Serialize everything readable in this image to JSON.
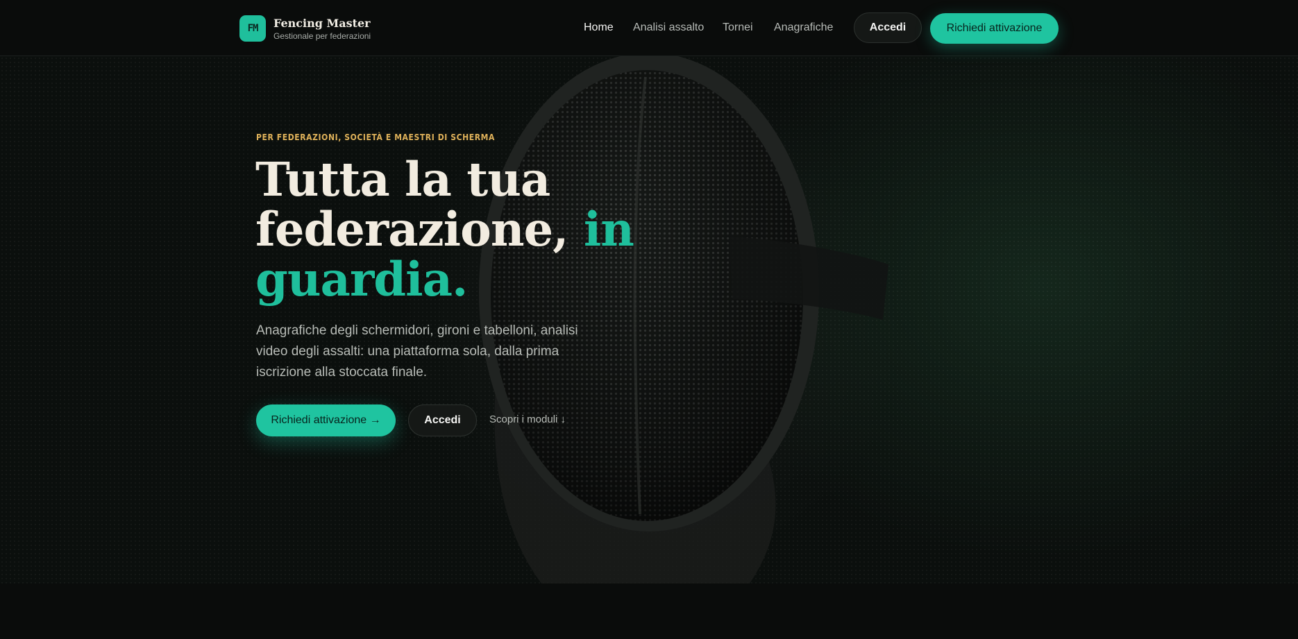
{
  "header": {
    "logo_text": "FM",
    "brand_name": "Fencing Master",
    "brand_subtitle": "Gestionale per federazioni",
    "nav": [
      {
        "label": "Home",
        "active": true
      },
      {
        "label": "Analisi assalto",
        "active": false
      },
      {
        "label": "Tornei",
        "active": false
      },
      {
        "label": "Anagrafiche",
        "active": false
      }
    ],
    "login_label": "Accedi",
    "cta_label": "Richiedi attivazione"
  },
  "hero": {
    "eyebrow": "PER FEDERAZIONI, SOCIETÀ E MAESTRI DI SCHERMA",
    "title_line1": "Tutta la tua",
    "title_line2": "federazione, ",
    "title_accent_1": "in",
    "title_accent_2": "guardia.",
    "description": "Anagrafiche degli schermidori, gironi e tabelloni, analisi video degli assalti: una piattaforma sola, dalla prima iscrizione alla stoccata finale.",
    "cta_primary": "Richiedi attivazione →",
    "cta_secondary": "Accedi",
    "cta_link": "Scopri i moduli ↓",
    "background_image": "fencing-mask"
  },
  "colors": {
    "accent": "#1fc4a0",
    "eyebrow": "#e0b25a",
    "background": "#0a0c0b",
    "title": "#f2ece0"
  }
}
